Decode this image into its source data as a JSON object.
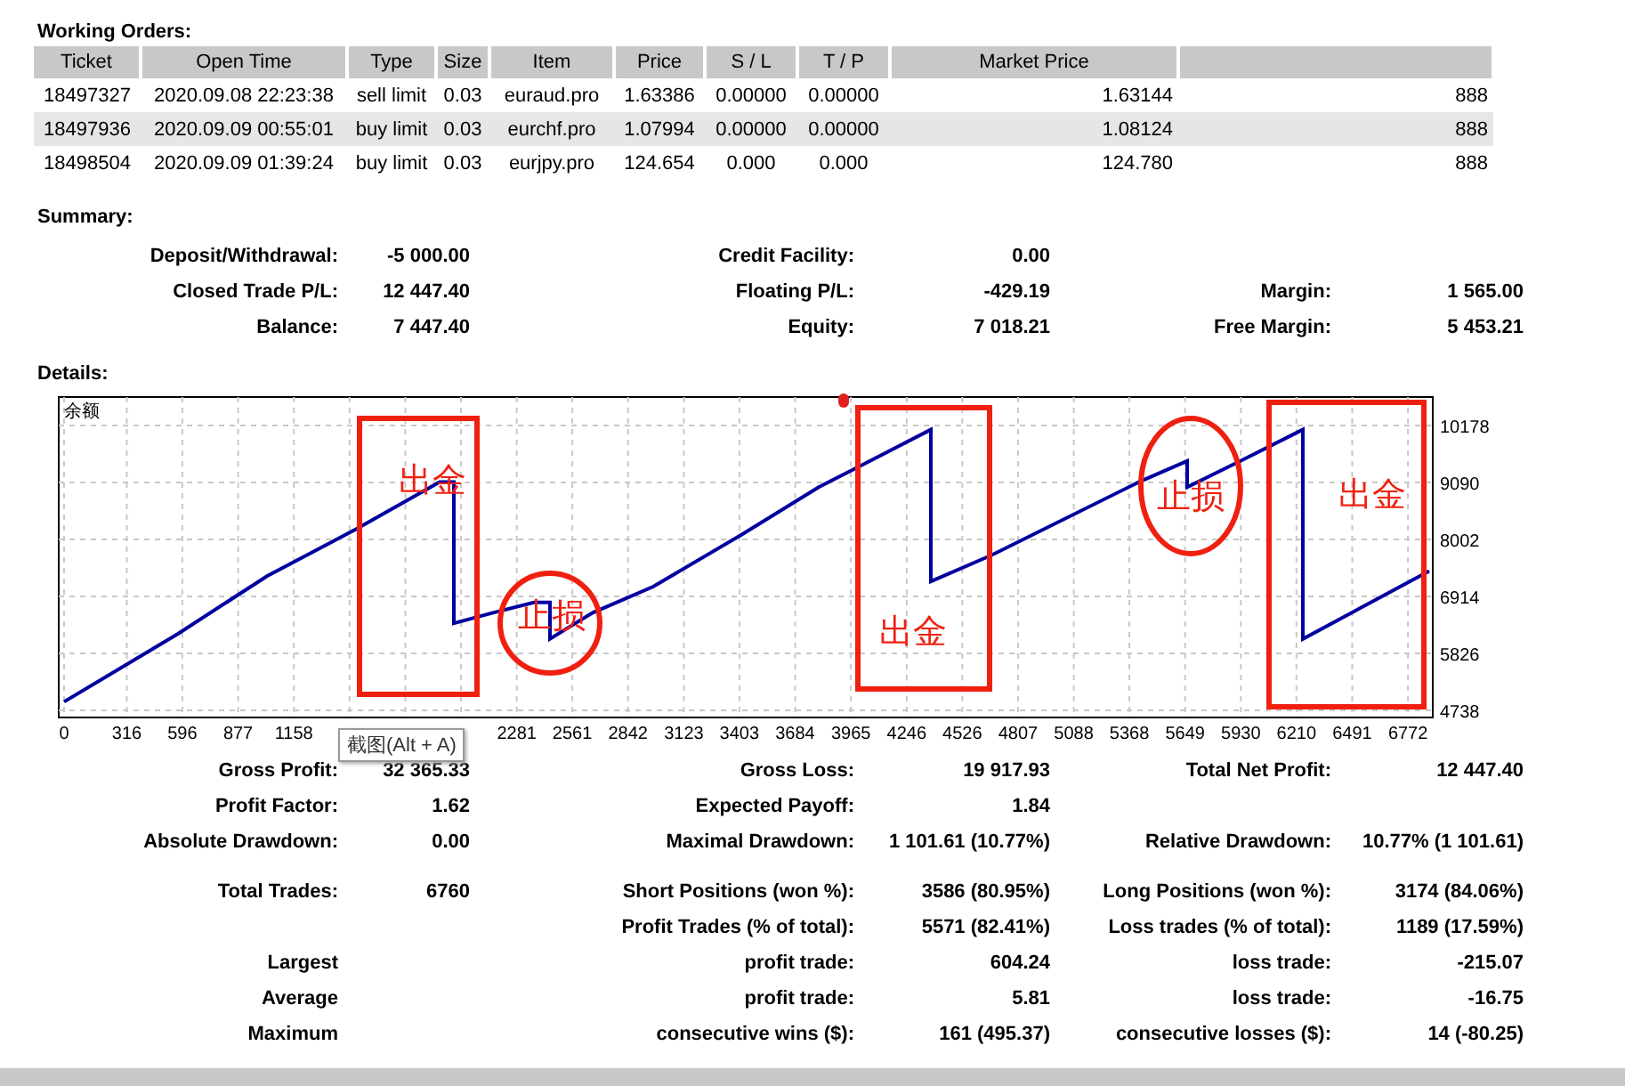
{
  "working_orders": {
    "title": "Working Orders:",
    "columns": [
      "Ticket",
      "Open Time",
      "Type",
      "Size",
      "Item",
      "Price",
      "S / L",
      "T / P",
      "Market Price"
    ],
    "rows": [
      {
        "cells": [
          "18497327",
          "2020.09.08 22:23:38",
          "sell limit",
          "0.03",
          "euraud.pro",
          "1.63386",
          "0.00000",
          "0.00000",
          "1.63144",
          "888"
        ]
      },
      {
        "cells": [
          "18497936",
          "2020.09.09 00:55:01",
          "buy limit",
          "0.03",
          "eurchf.pro",
          "1.07994",
          "0.00000",
          "0.00000",
          "1.08124",
          "888"
        ]
      },
      {
        "cells": [
          "18498504",
          "2020.09.09 01:39:24",
          "buy limit",
          "0.03",
          "eurjpy.pro",
          "124.654",
          "0.000",
          "0.000",
          "124.780",
          "888"
        ]
      }
    ]
  },
  "summary": {
    "title": "Summary:",
    "rows": [
      [
        {
          "label": "Deposit/Withdrawal:",
          "value": "-5 000.00"
        },
        {
          "label": "Credit Facility:",
          "value": "0.00"
        },
        null
      ],
      [
        {
          "label": "Closed Trade P/L:",
          "value": "12 447.40"
        },
        {
          "label": "Floating P/L:",
          "value": "-429.19"
        },
        {
          "label": "Margin:",
          "value": "1 565.00"
        }
      ],
      [
        {
          "label": "Balance:",
          "value": "7 447.40"
        },
        {
          "label": "Equity:",
          "value": "7 018.21"
        },
        {
          "label": "Free Margin:",
          "value": "5 453.21"
        }
      ]
    ]
  },
  "details": {
    "title": "Details:",
    "chart_data": {
      "type": "line",
      "x": [
        0,
        574,
        1022,
        1471,
        1892,
        1964,
        1964,
        2161,
        2368,
        2448,
        2448,
        2664,
        2969,
        3417,
        3803,
        4009,
        4368,
        4368,
        4673,
        5417,
        5659,
        5659,
        5928,
        6242,
        6242,
        6879
      ],
      "series": [
        {
          "name": "余额",
          "color": "#0000a0",
          "values": [
            4900,
            6200,
            7300,
            8200,
            9100,
            9100,
            6400,
            6600,
            6800,
            6800,
            6100,
            6600,
            7100,
            8100,
            9000,
            9400,
            10100,
            7200,
            7700,
            9100,
            9500,
            9000,
            9500,
            10100,
            6100,
            7400
          ]
        }
      ],
      "grid": true,
      "xlim": [
        -27,
        6897
      ],
      "ylim": [
        4602,
        10722
      ],
      "xticks": [
        0,
        316,
        596,
        877,
        1158,
        2281,
        2561,
        2842,
        3123,
        3403,
        3684,
        3965,
        4246,
        4526,
        4807,
        5088,
        5368,
        5649,
        5930,
        6210,
        6491,
        6772
      ],
      "yticks": [
        4738,
        5826,
        6914,
        8002,
        9090,
        10178
      ],
      "annotations": [
        "出金",
        "止损",
        "出金",
        "止损",
        "出金"
      ]
    },
    "tooltip": "截图(Alt + A)"
  },
  "stats": {
    "rows": [
      [
        {
          "label": "Gross Profit:",
          "value": "32 365.33"
        },
        {
          "label": "Gross Loss:",
          "value": "19 917.93"
        },
        {
          "label": "Total Net Profit:",
          "value": "12 447.40"
        }
      ],
      [
        {
          "label": "Profit Factor:",
          "value": "1.62"
        },
        {
          "label": "Expected Payoff:",
          "value": "1.84"
        },
        null
      ],
      [
        {
          "label": "Absolute Drawdown:",
          "value": "0.00"
        },
        {
          "label": "Maximal Drawdown:",
          "value": "1 101.61 (10.77%)"
        },
        {
          "label": "Relative Drawdown:",
          "value": "10.77% (1 101.61)"
        }
      ],
      [
        {
          "label": "Total Trades:",
          "value": "6760"
        },
        {
          "label": "Short Positions (won %):",
          "value": "3586 (80.95%)"
        },
        {
          "label": "Long Positions (won %):",
          "value": "3174 (84.06%)"
        }
      ],
      [
        null,
        {
          "label": "Profit Trades (% of total):",
          "value": "5571 (82.41%)"
        },
        {
          "label": "Loss trades (% of total):",
          "value": "1189 (17.59%)"
        }
      ],
      [
        {
          "label": "Largest"
        },
        {
          "label": "profit trade:",
          "value": "604.24"
        },
        {
          "label": "loss trade:",
          "value": "-215.07"
        }
      ],
      [
        {
          "label": "Average"
        },
        {
          "label": "profit trade:",
          "value": "5.81"
        },
        {
          "label": "loss trade:",
          "value": "-16.75"
        }
      ],
      [
        {
          "label": "Maximum"
        },
        {
          "label": "consecutive wins ($):",
          "value": "161 (495.37)"
        },
        {
          "label": "consecutive losses ($):",
          "value": "14 (-80.25)"
        }
      ]
    ]
  }
}
